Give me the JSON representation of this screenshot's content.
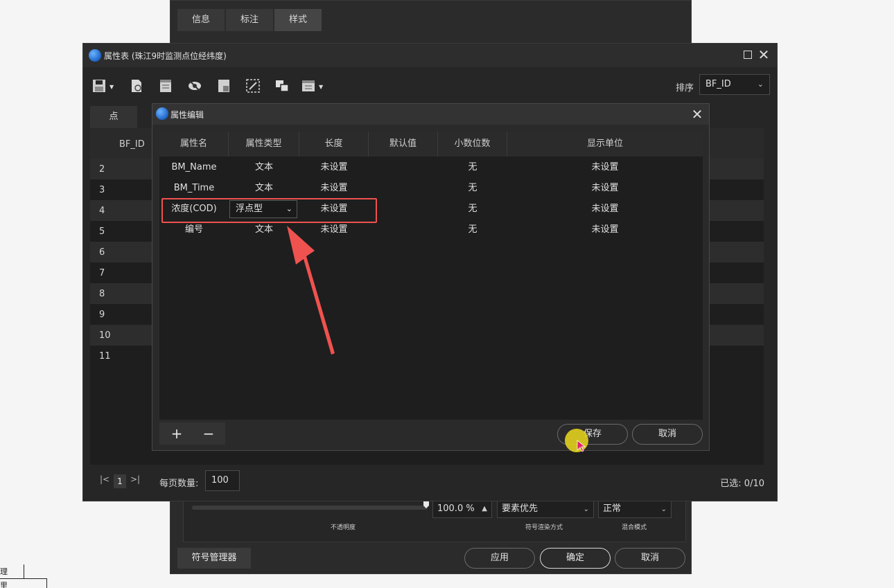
{
  "style_dialog": {
    "tabs": [
      "信息",
      "标注",
      "样式"
    ],
    "opacity_value": "100.0 %",
    "render_mode": "要素优先",
    "blend_mode": "正常",
    "caption_opacity": "不透明度",
    "caption_render": "符号渲染方式",
    "caption_blend": "混合模式",
    "symbol_manager": "符号管理器",
    "apply": "应用",
    "ok": "确定",
    "cancel": "取消"
  },
  "attr_window": {
    "title": "属性表 (珠江9时监测点位经纬度)",
    "sort_label": "排序",
    "sort_value": "BF_ID",
    "tab": "点",
    "column_bf_id": "BF_ID",
    "row_numbers": [
      "2",
      "3",
      "4",
      "5",
      "6",
      "7",
      "8",
      "9",
      "10",
      "11"
    ],
    "pager": {
      "first": "|<",
      "current": "1",
      "last": ">|",
      "page_size_label": "每页数量:",
      "page_size": "100",
      "selected": "已选: 0/10"
    }
  },
  "prop_dialog": {
    "title": "属性编辑",
    "columns": [
      "属性名",
      "属性类型",
      "长度",
      "默认值",
      "小数位数",
      "显示单位"
    ],
    "rows": [
      {
        "name": "BM_Name",
        "type": "文本",
        "length": "未设置",
        "default": "",
        "decimals": "无",
        "unit": "未设置"
      },
      {
        "name": "BM_Time",
        "type": "文本",
        "length": "未设置",
        "default": "",
        "decimals": "无",
        "unit": "未设置"
      },
      {
        "name": "浓度(COD)",
        "type": "浮点型",
        "length": "未设置",
        "default": "",
        "decimals": "无",
        "unit": "未设置"
      },
      {
        "name": "编号",
        "type": "文本",
        "length": "未设置",
        "default": "",
        "decimals": "无",
        "unit": "未设置"
      }
    ],
    "add": "+",
    "remove": "−",
    "save": "保存",
    "cancel": "取消"
  },
  "bg_sketch": [
    "理",
    "里"
  ],
  "colors": {
    "highlight": "#f0524f",
    "cursor": "#e2d01e"
  }
}
